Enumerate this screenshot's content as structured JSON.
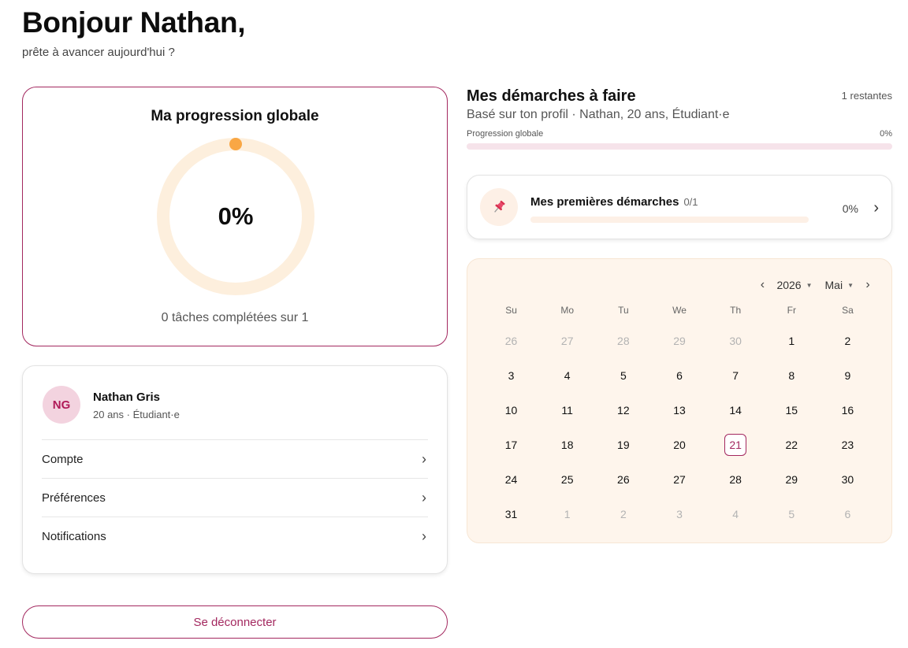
{
  "header": {
    "greeting": "Bonjour Nathan,",
    "subtitle": "prête à avancer aujourd'hui ?"
  },
  "progress": {
    "title": "Ma progression globale",
    "value_label": "0%",
    "value": 0,
    "footnote": "0 tâches complétées sur 1",
    "colors": {
      "ring": "#fdefdd",
      "dot": "#f9a745"
    }
  },
  "profile": {
    "initials": "NG",
    "name": "Nathan Gris",
    "meta": "20 ans · Étudiant·e",
    "menu": [
      {
        "label": "Compte",
        "icon": "chevron-right-icon"
      },
      {
        "label": "Préférences",
        "icon": "chevron-right-icon"
      },
      {
        "label": "Notifications",
        "icon": "chevron-right-icon"
      }
    ]
  },
  "logout_label": "Se déconnecter",
  "tasks": {
    "title": "Mes démarches à faire",
    "remaining": "1 restantes",
    "subtitle": "Basé sur ton profil · Nathan, 20 ans, Étudiant·e",
    "bar_label": "Progression globale",
    "bar_pct": "0%",
    "bar_value": 0,
    "groups": [
      {
        "name": "Mes premières démarches",
        "count": "0/1",
        "pct": "0%",
        "value": 0,
        "icon": "pushpin-icon"
      }
    ]
  },
  "calendar": {
    "year": "2026",
    "month": "Mai",
    "prev_icon": "chevron-left-icon",
    "next_icon": "chevron-right-icon",
    "weekdays": [
      "Su",
      "Mo",
      "Tu",
      "We",
      "Th",
      "Fr",
      "Sa"
    ],
    "days": [
      {
        "d": "26",
        "muted": true
      },
      {
        "d": "27",
        "muted": true
      },
      {
        "d": "28",
        "muted": true
      },
      {
        "d": "29",
        "muted": true
      },
      {
        "d": "30",
        "muted": true
      },
      {
        "d": "1"
      },
      {
        "d": "2"
      },
      {
        "d": "3"
      },
      {
        "d": "4"
      },
      {
        "d": "5"
      },
      {
        "d": "6"
      },
      {
        "d": "7"
      },
      {
        "d": "8"
      },
      {
        "d": "9"
      },
      {
        "d": "10"
      },
      {
        "d": "11"
      },
      {
        "d": "12"
      },
      {
        "d": "13"
      },
      {
        "d": "14"
      },
      {
        "d": "15"
      },
      {
        "d": "16"
      },
      {
        "d": "17"
      },
      {
        "d": "18"
      },
      {
        "d": "19"
      },
      {
        "d": "20"
      },
      {
        "d": "21",
        "today": true
      },
      {
        "d": "22"
      },
      {
        "d": "23"
      },
      {
        "d": "24"
      },
      {
        "d": "25"
      },
      {
        "d": "26"
      },
      {
        "d": "27"
      },
      {
        "d": "28"
      },
      {
        "d": "29"
      },
      {
        "d": "30"
      },
      {
        "d": "31"
      },
      {
        "d": "1",
        "muted": true
      },
      {
        "d": "2",
        "muted": true
      },
      {
        "d": "3",
        "muted": true
      },
      {
        "d": "4",
        "muted": true
      },
      {
        "d": "5",
        "muted": true
      },
      {
        "d": "6",
        "muted": true
      }
    ]
  },
  "colors": {
    "accent": "#a3285f",
    "avatar_bg": "#f3d3df",
    "calendar_bg": "#fef5ec"
  }
}
